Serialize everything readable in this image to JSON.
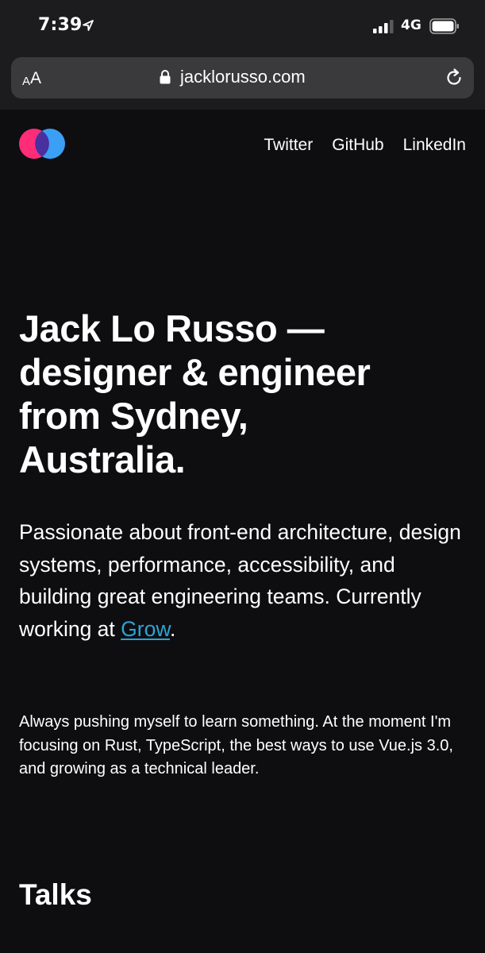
{
  "status_bar": {
    "time": "7:39",
    "network": "4G",
    "icons": [
      "location-arrow-icon",
      "signal-bars-icon",
      "battery-icon"
    ]
  },
  "browser": {
    "text_size_label_small": "A",
    "text_size_label_large": "A",
    "url": "jacklorusso.com",
    "icons": [
      "lock-icon",
      "reload-icon"
    ]
  },
  "site": {
    "logo": "overlapping-circles-logo",
    "colors": {
      "logo_pink": "#ff2d78",
      "logo_blue": "#3a9ff5",
      "logo_overlap": "#4a2f9e",
      "link": "#2ba3d8"
    },
    "nav": [
      {
        "label": "Twitter"
      },
      {
        "label": "GitHub"
      },
      {
        "label": "LinkedIn"
      }
    ]
  },
  "hero": {
    "line1": "Jack Lo Russo —",
    "line2": "designer & engineer",
    "line3": "from Sydney,",
    "line4": "Australia."
  },
  "intro": {
    "text_before": "Passionate about front-end architecture, design systems, performance, accessibility, and building great engineering teams. Currently working at ",
    "link": "Grow",
    "text_after": "."
  },
  "learning": {
    "text": "Always pushing myself to learn something. At the moment I'm focusing on Rust, TypeScript, the best ways to use Vue.js 3.0, and growing as a technical leader."
  },
  "talks": {
    "title": "Talks"
  }
}
